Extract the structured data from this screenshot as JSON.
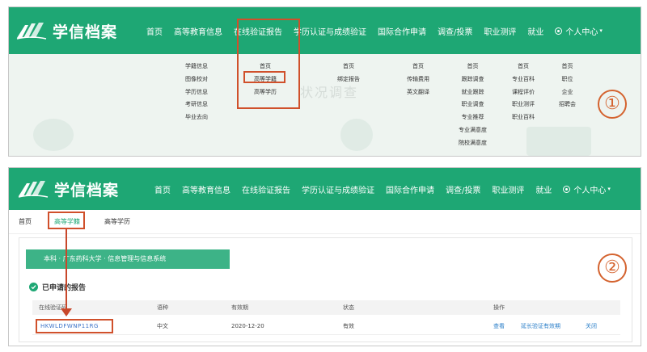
{
  "brand": {
    "name": "学信档案",
    "color": "#1ea774"
  },
  "nav": {
    "items": [
      "首页",
      "高等教育信息",
      "在线验证报告",
      "学历认证与成绩验证",
      "国际合作申请",
      "调查/投票",
      "职业测评",
      "就业"
    ],
    "user_menu": "个人中心"
  },
  "dropdown": {
    "col1": [
      "学籍信息",
      "图像校对",
      "学历信息",
      "考研信息",
      "毕业去向"
    ],
    "col2": [
      "首页",
      "高等学籍",
      "高等学历"
    ],
    "col3": [
      "首页",
      "绑定报告"
    ],
    "col4": [
      "首页",
      "传输费用",
      "英文翻译"
    ],
    "col5": [
      "首页",
      "跟踪调查",
      "就业跟踪",
      "职业调查",
      "专业推荐",
      "专业满意度",
      "院校满意度"
    ],
    "col6": [
      "首页",
      "专业百科",
      "课程评价",
      "职业测评",
      "职业百科"
    ],
    "col7": [
      "首页",
      "职位",
      "企业",
      "招聘会"
    ],
    "ghost_title": "状况调查"
  },
  "markers": {
    "step1": "①",
    "step2": "②"
  },
  "subnav": [
    "首页",
    "高等学籍",
    "高等学历"
  ],
  "report": {
    "banner": "本科 · 广东药科大学 · 信息管理与信息系统",
    "section_title": "已申请的报告",
    "columns": [
      "在线验证码",
      "语种",
      "有效期",
      "状态",
      "操作"
    ],
    "row": {
      "code": "HKWLDFWNP11RG",
      "language": "中文",
      "expiry": "2020-12-20",
      "status": "有效",
      "actions": [
        "查看",
        "延长验证有效期",
        "关闭"
      ]
    }
  }
}
